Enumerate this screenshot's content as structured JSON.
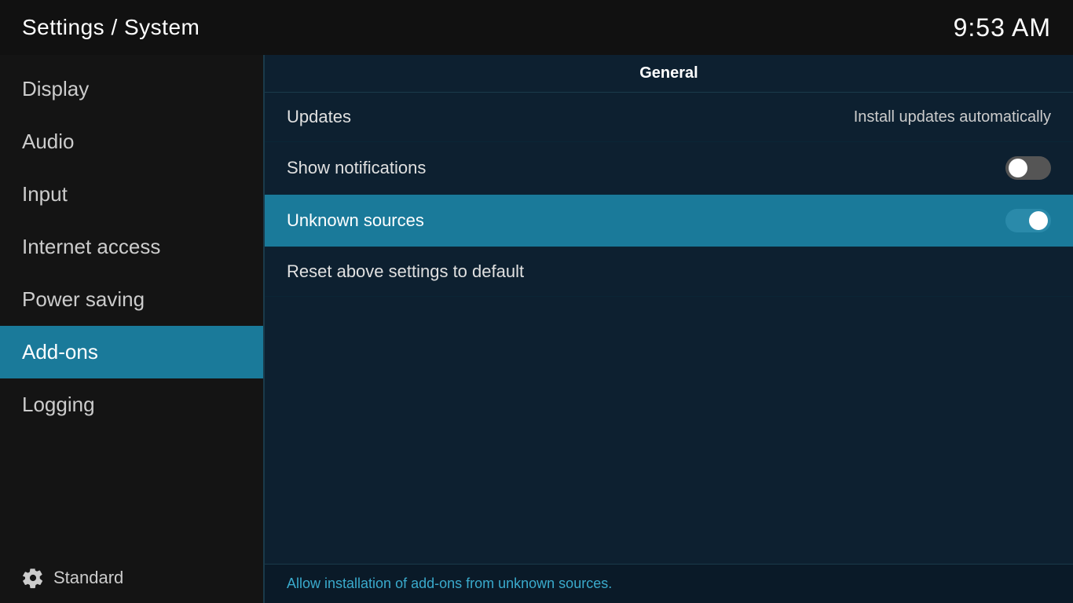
{
  "header": {
    "title": "Settings / System",
    "time": "9:53 AM"
  },
  "sidebar": {
    "items": [
      {
        "id": "display",
        "label": "Display",
        "active": false
      },
      {
        "id": "audio",
        "label": "Audio",
        "active": false
      },
      {
        "id": "input",
        "label": "Input",
        "active": false
      },
      {
        "id": "internet-access",
        "label": "Internet access",
        "active": false
      },
      {
        "id": "power-saving",
        "label": "Power saving",
        "active": false
      },
      {
        "id": "add-ons",
        "label": "Add-ons",
        "active": true
      },
      {
        "id": "logging",
        "label": "Logging",
        "active": false
      }
    ],
    "footer": {
      "label": "Standard",
      "icon": "gear"
    }
  },
  "content": {
    "section_title": "General",
    "rows": [
      {
        "id": "updates",
        "label": "Updates",
        "value": "Install updates automatically",
        "toggle": null,
        "highlighted": false
      },
      {
        "id": "show-notifications",
        "label": "Show notifications",
        "value": null,
        "toggle": "off",
        "highlighted": false
      },
      {
        "id": "unknown-sources",
        "label": "Unknown sources",
        "value": null,
        "toggle": "on",
        "highlighted": true
      },
      {
        "id": "reset-above-settings",
        "label": "Reset above settings to default",
        "value": null,
        "toggle": null,
        "highlighted": false
      }
    ],
    "description": "Allow installation of add-ons from unknown sources."
  }
}
